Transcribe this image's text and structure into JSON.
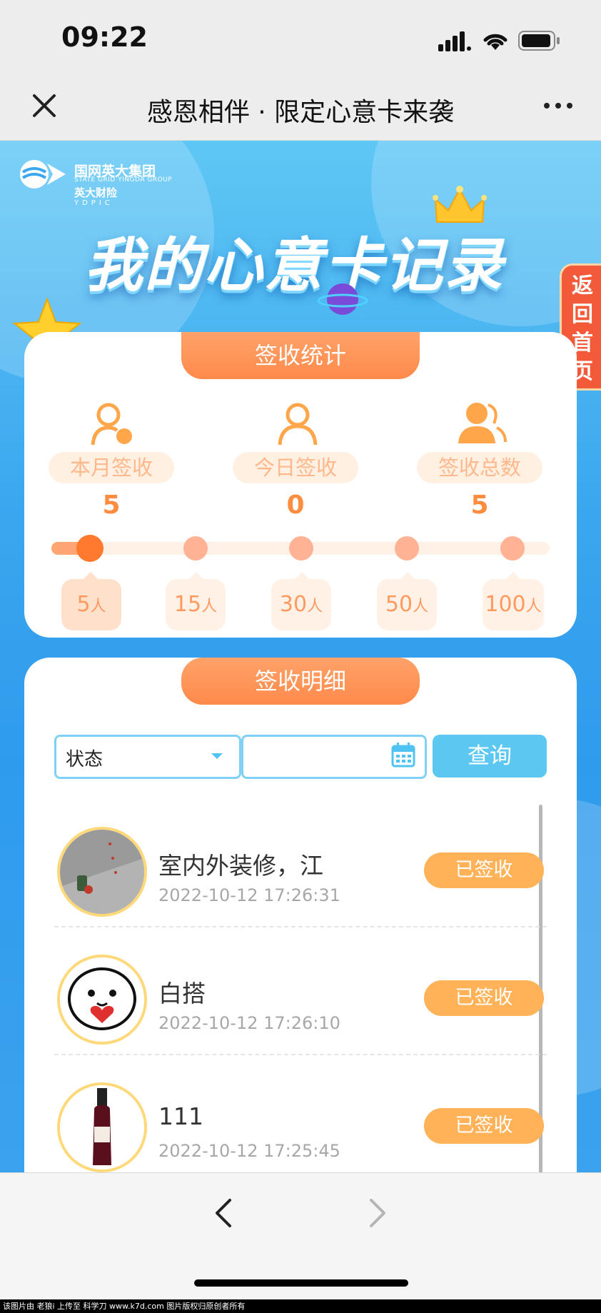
{
  "status_bar": {
    "time": "09:22"
  },
  "nav": {
    "title": "感恩相伴 · 限定心意卡来袭"
  },
  "banner": {
    "logo_cn": "国网英大集团",
    "logo_en": "STATE GRID YINGDA GROUP",
    "logo_sub": "英大财险",
    "logo_abbr": "YDPIC",
    "title": "我的心意卡记录",
    "back_home": "返回首页"
  },
  "stats": {
    "tab": "签收统计",
    "items": [
      {
        "label": "本月签收",
        "value": "5",
        "icon": "user-clock-icon"
      },
      {
        "label": "今日签收",
        "value": "0",
        "icon": "user-icon"
      },
      {
        "label": "签收总数",
        "value": "5",
        "icon": "users-icon"
      }
    ],
    "progress_fraction": 0.0,
    "tiers": [
      {
        "num": "5",
        "unit": "人"
      },
      {
        "num": "15",
        "unit": "人"
      },
      {
        "num": "30",
        "unit": "人"
      },
      {
        "num": "50",
        "unit": "人"
      },
      {
        "num": "100",
        "unit": "人"
      }
    ]
  },
  "detail": {
    "tab": "签收明细",
    "filter": {
      "status_value": "状态",
      "date_value": "",
      "query_label": "查询"
    },
    "records": [
      {
        "name": "室内外装修，江",
        "time": "2022-10-12 17:26:31",
        "status": "已签收"
      },
      {
        "name": "白搭",
        "time": "2022-10-12 17:26:10",
        "status": "已签收"
      },
      {
        "name": "111",
        "time": "2022-10-12 17:25:45",
        "status": "已签收"
      }
    ]
  },
  "watermark": "该图片由 老狼i 上传至 科学刀 www.k7d.com 图片版权归原创者所有",
  "colors": {
    "accent_orange": "#ff8a4a",
    "sky_blue": "#3ba7ef",
    "query_blue": "#5cc8f2"
  }
}
